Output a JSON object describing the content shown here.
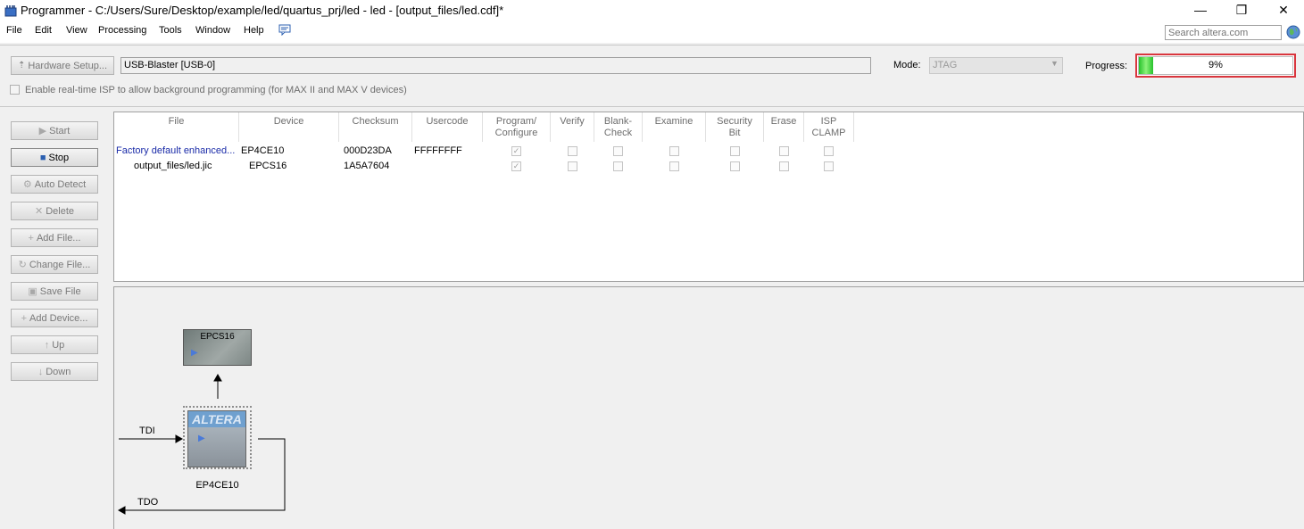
{
  "window": {
    "title": "Programmer - C:/Users/Sure/Desktop/example/led/quartus_prj/led - led - [output_files/led.cdf]*",
    "minimize": "—",
    "maximize": "❐",
    "close": "✕"
  },
  "menu": [
    "File",
    "Edit",
    "View",
    "Processing",
    "Tools",
    "Window",
    "Help"
  ],
  "search": {
    "placeholder": "Search altera.com"
  },
  "hardware": {
    "setup_label": "Hardware Setup...",
    "value": "USB-Blaster [USB-0]",
    "mode_label": "Mode:",
    "mode_value": "JTAG",
    "progress_label": "Progress:",
    "progress_text": "9%",
    "progress_fraction": 0.09,
    "isp_label": "Enable real-time ISP to allow background programming (for MAX II and MAX V devices)"
  },
  "sidebar": {
    "buttons": [
      {
        "label": "Start",
        "icon": "play-icon",
        "enabled": false
      },
      {
        "label": "Stop",
        "icon": "stop-icon",
        "enabled": true
      },
      {
        "label": "Auto Detect",
        "icon": "auto-detect-icon",
        "enabled": false
      },
      {
        "label": "Delete",
        "icon": "delete-icon",
        "enabled": false
      },
      {
        "label": "Add File...",
        "icon": "add-file-icon",
        "enabled": false
      },
      {
        "label": "Change File...",
        "icon": "change-file-icon",
        "enabled": false
      },
      {
        "label": "Save File",
        "icon": "save-file-icon",
        "enabled": false
      },
      {
        "label": "Add Device...",
        "icon": "add-device-icon",
        "enabled": false
      },
      {
        "label": "Up",
        "icon": "up-icon",
        "enabled": false
      },
      {
        "label": "Down",
        "icon": "down-icon",
        "enabled": false
      }
    ]
  },
  "table": {
    "columns": [
      "File",
      "Device",
      "Checksum",
      "Usercode",
      "Program/\nConfigure",
      "Verify",
      "Blank-\nCheck",
      "Examine",
      "Security\nBit",
      "Erase",
      "ISP\nCLAMP"
    ],
    "rows": [
      {
        "file": "Factory default enhanced...",
        "device": "EP4CE10",
        "checksum": "000D23DA",
        "usercode": "FFFFFFFF",
        "program": true,
        "verify": false,
        "blank": false,
        "examine": false,
        "security": false,
        "erase": false,
        "isp": false
      },
      {
        "file": "output_files/led.jic",
        "device": "EPCS16",
        "checksum": "1A5A7604",
        "usercode": "",
        "program": true,
        "verify": false,
        "blank": false,
        "examine": false,
        "security": false,
        "erase": false,
        "isp": false
      }
    ]
  },
  "diagram": {
    "flash_label": "EPCS16",
    "fpga_label": "EP4CE10",
    "logo_text": "ALTERA",
    "tdi": "TDI",
    "tdo": "TDO"
  },
  "colors": {
    "progress_border": "#d9363e",
    "progress_fill": "#27c22c",
    "file_link": "#1a2ba8"
  }
}
